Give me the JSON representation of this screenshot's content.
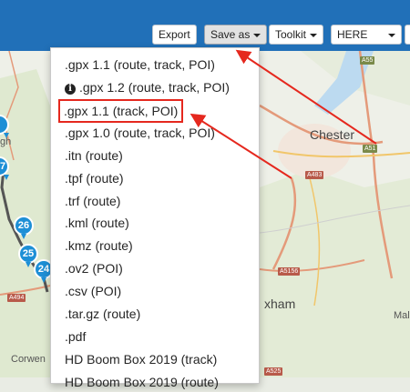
{
  "toolbar": {
    "export_label": "Export",
    "save_as_label": "Save as",
    "toolkit_label": "Toolkit",
    "map_select_value": "HERE"
  },
  "map": {
    "labels": {
      "chester": "Chester",
      "xham": "xham",
      "corwen": "Corwen",
      "gh": "gh",
      "mal": "Mal"
    },
    "road_shields": {
      "a55": "A55",
      "a51": "A51",
      "a483": "A483",
      "a5156": "A5156",
      "a494": "A494",
      "a525": "A525"
    },
    "markers": [
      "26",
      "25",
      "24",
      "7"
    ]
  },
  "save_menu": {
    "items": [
      ".gpx 1.1 (route, track, POI)",
      ".gpx 1.2 (route, track, POI)",
      ".gpx 1.1 (track, POI)",
      ".gpx 1.0 (route, track, POI)",
      ".itn (route)",
      ".tpf (route)",
      ".trf (route)",
      ".kml (route)",
      ".kmz (route)",
      ".ov2 (POI)",
      ".csv (POI)",
      ".tar.gz (route)",
      ".pdf",
      "HD Boom Box 2019 (track)",
      "HD Boom Box 2019 (route)"
    ],
    "info_icon_glyph": "i"
  },
  "colors": {
    "toolbar_bg": "#2170b8",
    "annotation_red": "#e5281e",
    "marker_blue": "#1d8fd6"
  }
}
